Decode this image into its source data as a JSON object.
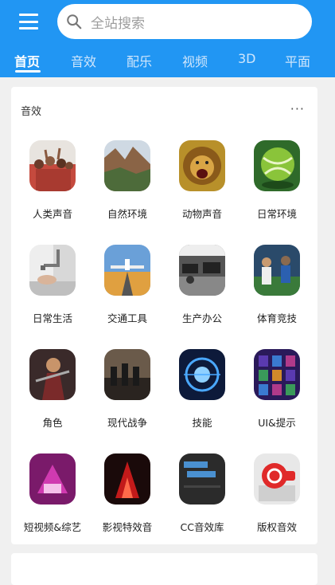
{
  "search": {
    "placeholder": "全站搜索"
  },
  "tabs": [
    {
      "label": "首页"
    },
    {
      "label": "音效"
    },
    {
      "label": "配乐"
    },
    {
      "label": "视频"
    },
    {
      "label": "3D"
    },
    {
      "label": "平面"
    }
  ],
  "section": {
    "title": "音效",
    "more": "···",
    "items": [
      {
        "label": "人类声音"
      },
      {
        "label": "自然环境"
      },
      {
        "label": "动物声音"
      },
      {
        "label": "日常环境"
      },
      {
        "label": "日常生活"
      },
      {
        "label": "交通工具"
      },
      {
        "label": "生产办公"
      },
      {
        "label": "体育竞技"
      },
      {
        "label": "角色"
      },
      {
        "label": "现代战争"
      },
      {
        "label": "技能"
      },
      {
        "label": "UI&提示"
      },
      {
        "label": "短视频&综艺"
      },
      {
        "label": "影视特效音"
      },
      {
        "label": "CC音效库"
      },
      {
        "label": "版权音效"
      }
    ]
  },
  "colors": {
    "header": "#2196f3",
    "background": "#f0f0f0"
  }
}
